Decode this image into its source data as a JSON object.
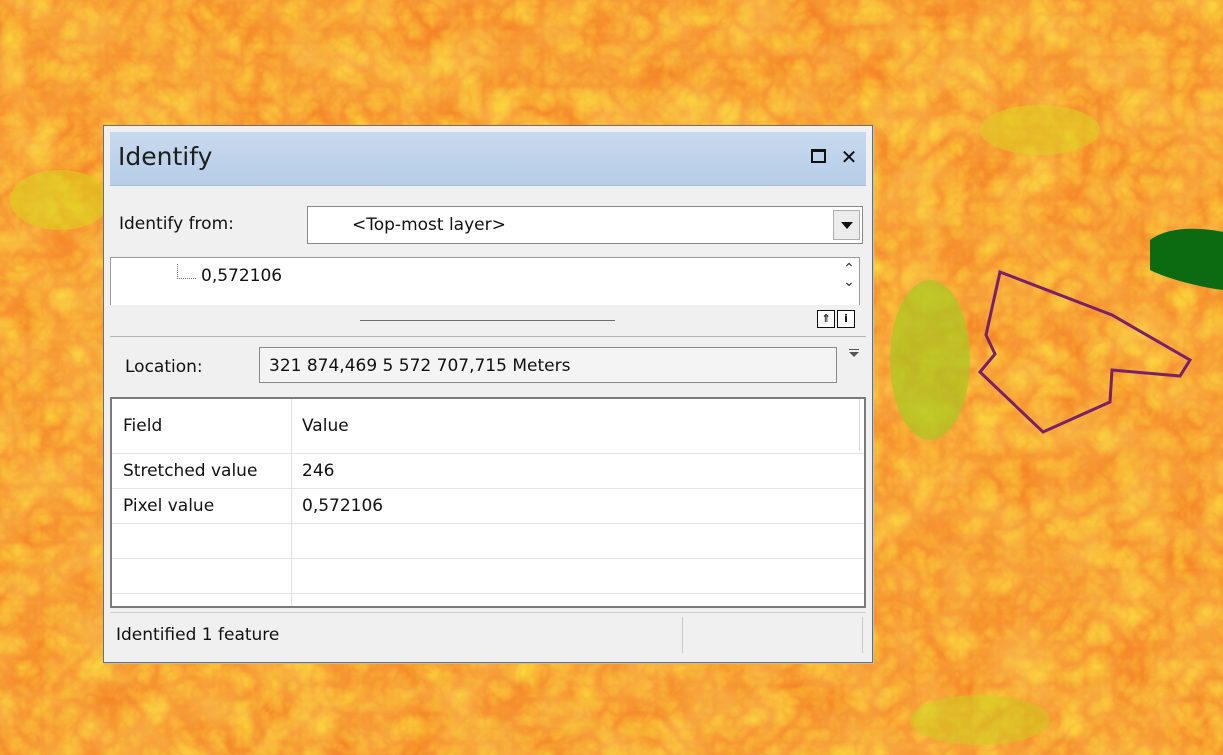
{
  "dialog": {
    "title": "Identify",
    "identify_from_label": "Identify from:",
    "identify_from_value": "<Top-most layer>",
    "tree_node": "0,572106",
    "location_label": "Location:",
    "location_value": "321 874,469  5 572 707,715 Meters",
    "table": {
      "headers": [
        "Field",
        "Value"
      ],
      "rows": [
        [
          "Stretched value",
          "246"
        ],
        [
          "Pixel value",
          "0,572106"
        ]
      ]
    },
    "status_text": "Identified 1 feature"
  },
  "icons": {
    "maximize": "maximize-icon",
    "close": "close-icon",
    "dropdown": "chevron-down-icon",
    "scroll": "scroll-arrows-icon",
    "expand": "expand-icon",
    "info": "info-icon",
    "options": "options-arrow-icon"
  },
  "colors": {
    "titlebar": "#c0d4ec",
    "map_orange": "#f47a1e",
    "map_yellow": "#f2c21a",
    "map_green": "#a6c61a",
    "dark_green": "#0e6b12",
    "polygon": "#7a1f6a"
  }
}
